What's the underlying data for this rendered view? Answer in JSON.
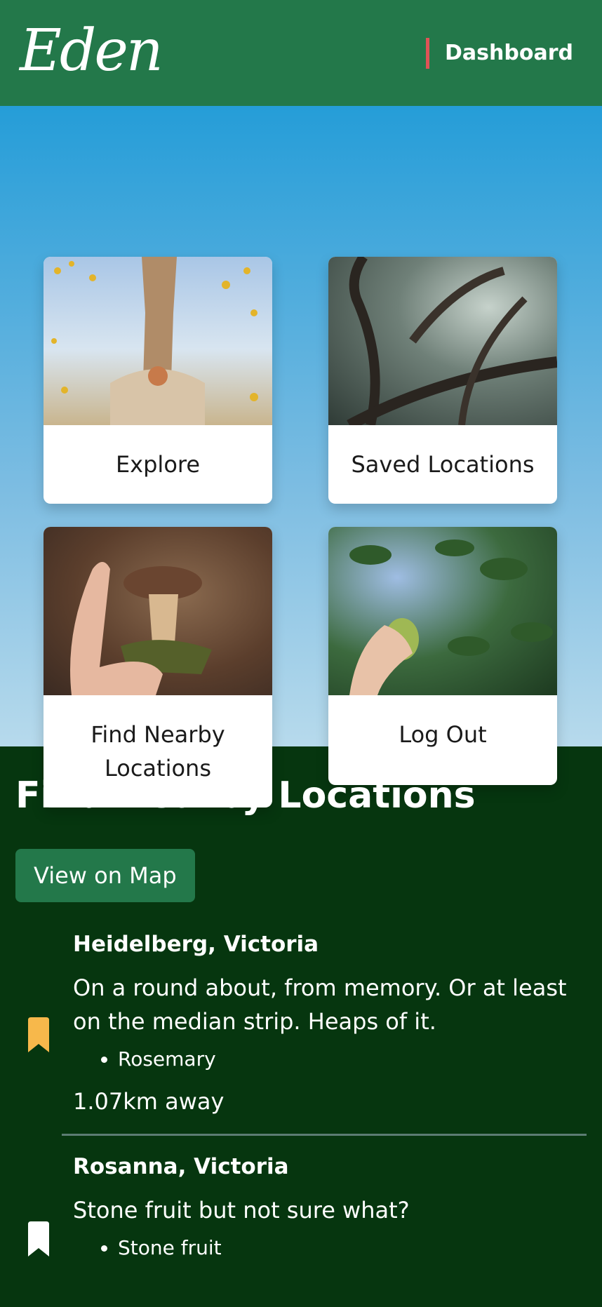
{
  "header": {
    "logo_text": "Eden",
    "nav_label": "Dashboard"
  },
  "cards": [
    {
      "label": "Explore",
      "image": "person-in-flowers"
    },
    {
      "label": "Saved Locations",
      "image": "misty-forest-trees"
    },
    {
      "label": "Find Nearby Locations",
      "image": "hand-holding-mushroom"
    },
    {
      "label": "Log Out",
      "image": "hand-picking-pear"
    }
  ],
  "nearby": {
    "title": "Find Nearby Locations",
    "map_button": "View on Map",
    "locations": [
      {
        "name": "Heidelberg, Victoria",
        "description": "On a round about, from memory. Or at least on the median strip. Heaps of it.",
        "tags": [
          "Rosemary"
        ],
        "distance": "1.07km away",
        "bookmark_color": "#f7b84b",
        "bookmark_icon": "bookmark-filled-icon"
      },
      {
        "name": "Rosanna, Victoria",
        "description": "Stone fruit but not sure what?",
        "tags": [
          "Stone fruit"
        ],
        "bookmark_color": "#ffffff",
        "bookmark_icon": "bookmark-icon"
      }
    ]
  },
  "colors": {
    "header_bg": "#23784a",
    "accent_bar": "#e05356",
    "section_bg": "#06360f",
    "button_bg": "#23784a"
  }
}
